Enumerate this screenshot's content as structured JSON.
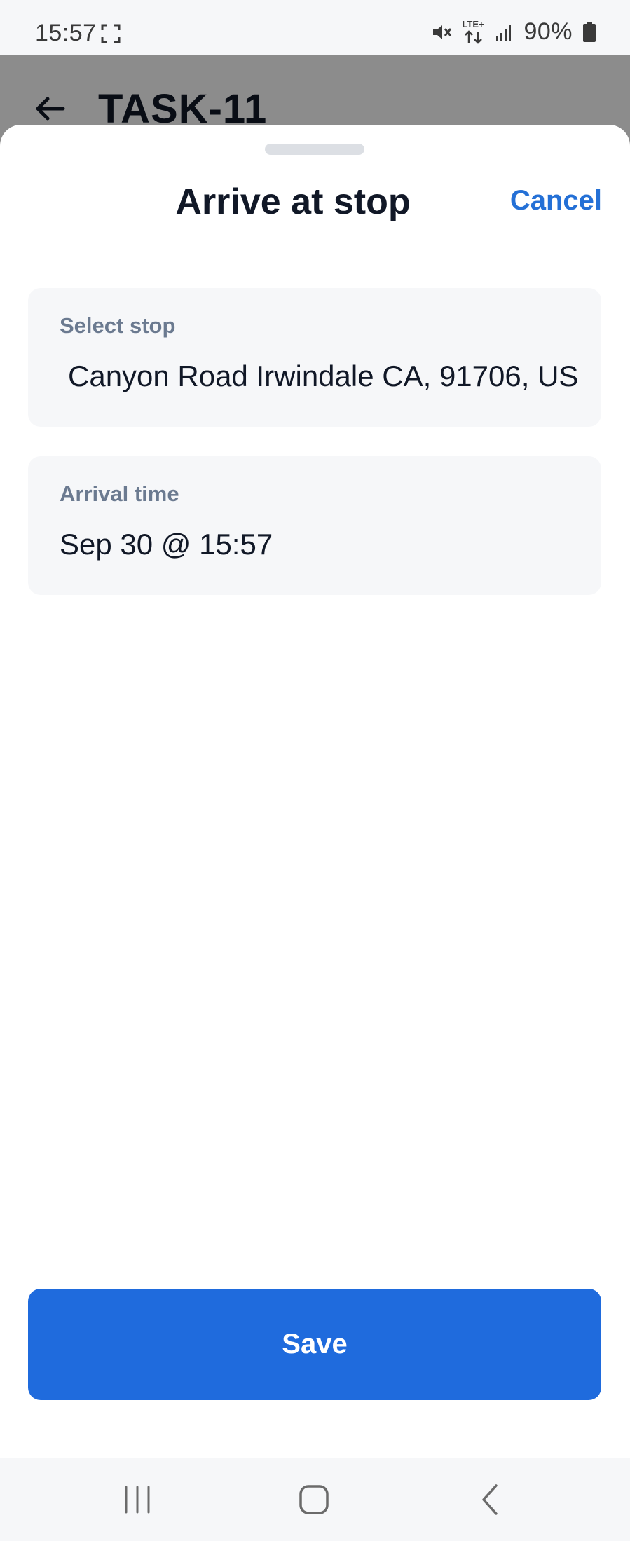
{
  "status_bar": {
    "time": "15:57",
    "network_label": "LTE+",
    "battery": "90%"
  },
  "background_page": {
    "title": "TASK-11"
  },
  "sheet": {
    "title": "Arrive at stop",
    "cancel_label": "Cancel",
    "fields": {
      "stop": {
        "label": "Select stop",
        "value": "Canyon Road Irwindale CA, 91706, US"
      },
      "arrival_time": {
        "label": "Arrival time",
        "value": "Sep 30 @ 15:57"
      }
    },
    "save_label": "Save"
  },
  "icons": {
    "back": "arrow-left-icon",
    "screenshot": "screenshot-frame-icon",
    "mute": "mute-icon",
    "network": "lte-data-icon",
    "signal": "signal-bars-icon",
    "battery": "battery-icon",
    "nav_recents": "recents-icon",
    "nav_home": "home-icon",
    "nav_back": "back-chevron-icon"
  },
  "colors": {
    "accent": "#1f6bdd",
    "cancel": "#2470d6",
    "label": "#6b7a90",
    "card_background": "#f6f7f9",
    "scrim": "rgba(0,0,0,0.45)"
  }
}
